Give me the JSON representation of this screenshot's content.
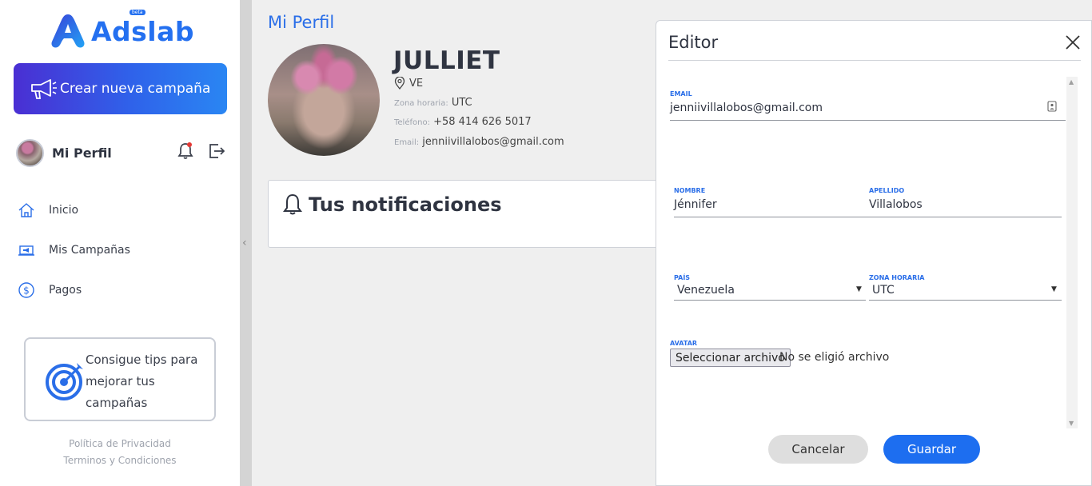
{
  "brand": {
    "name": "Adslab",
    "badge": "beta",
    "color": "#2470f0"
  },
  "sidebar": {
    "create_campaign": "Crear nueva campaña",
    "profile_label": "Mi Perfil",
    "items": [
      {
        "label": "Inicio",
        "icon": "home-icon"
      },
      {
        "label": "Mis Campañas",
        "icon": "campaigns-icon"
      },
      {
        "label": "Pagos",
        "icon": "dollar-icon"
      }
    ],
    "tips_text": "Consigue tips para mejorar tus campañas",
    "footer": {
      "privacy": "Política de Privacidad",
      "terms": "Terminos y Condiciones"
    }
  },
  "main": {
    "title": "Mi Perfil",
    "user_name": "JULLIET",
    "country": "VE",
    "timezone_label": "Zona horaria:",
    "timezone_value": "UTC",
    "phone_label": "Teléfono:",
    "phone_value": "+58 414 626 5017",
    "email_label": "Email:",
    "email_value": "jenniivillalobos@gmail.com",
    "notifications_title": "Tus notificaciones"
  },
  "editor": {
    "title": "Editor",
    "email_label": "EMAIL",
    "email_value": "jenniivillalobos@gmail.com",
    "first_name_label": "NOMBRE",
    "first_name_value": "Jénnifer",
    "last_name_label": "APELLIDO",
    "last_name_value": "Villalobos",
    "country_label": "PAÍS",
    "country_value": "Venezuela",
    "tz_label": "ZONA HORARIA",
    "tz_value": "UTC",
    "avatar_label": "AVATAR",
    "file_button": "Seleccionar archivo",
    "file_status": "No se eligió archivo",
    "cancel": "Cancelar",
    "save": "Guardar"
  },
  "colors": {
    "accent": "#2a6ee8",
    "save_button": "#1d6ef0",
    "cancel_button": "#dedede",
    "notification_dot": "#e53935"
  }
}
